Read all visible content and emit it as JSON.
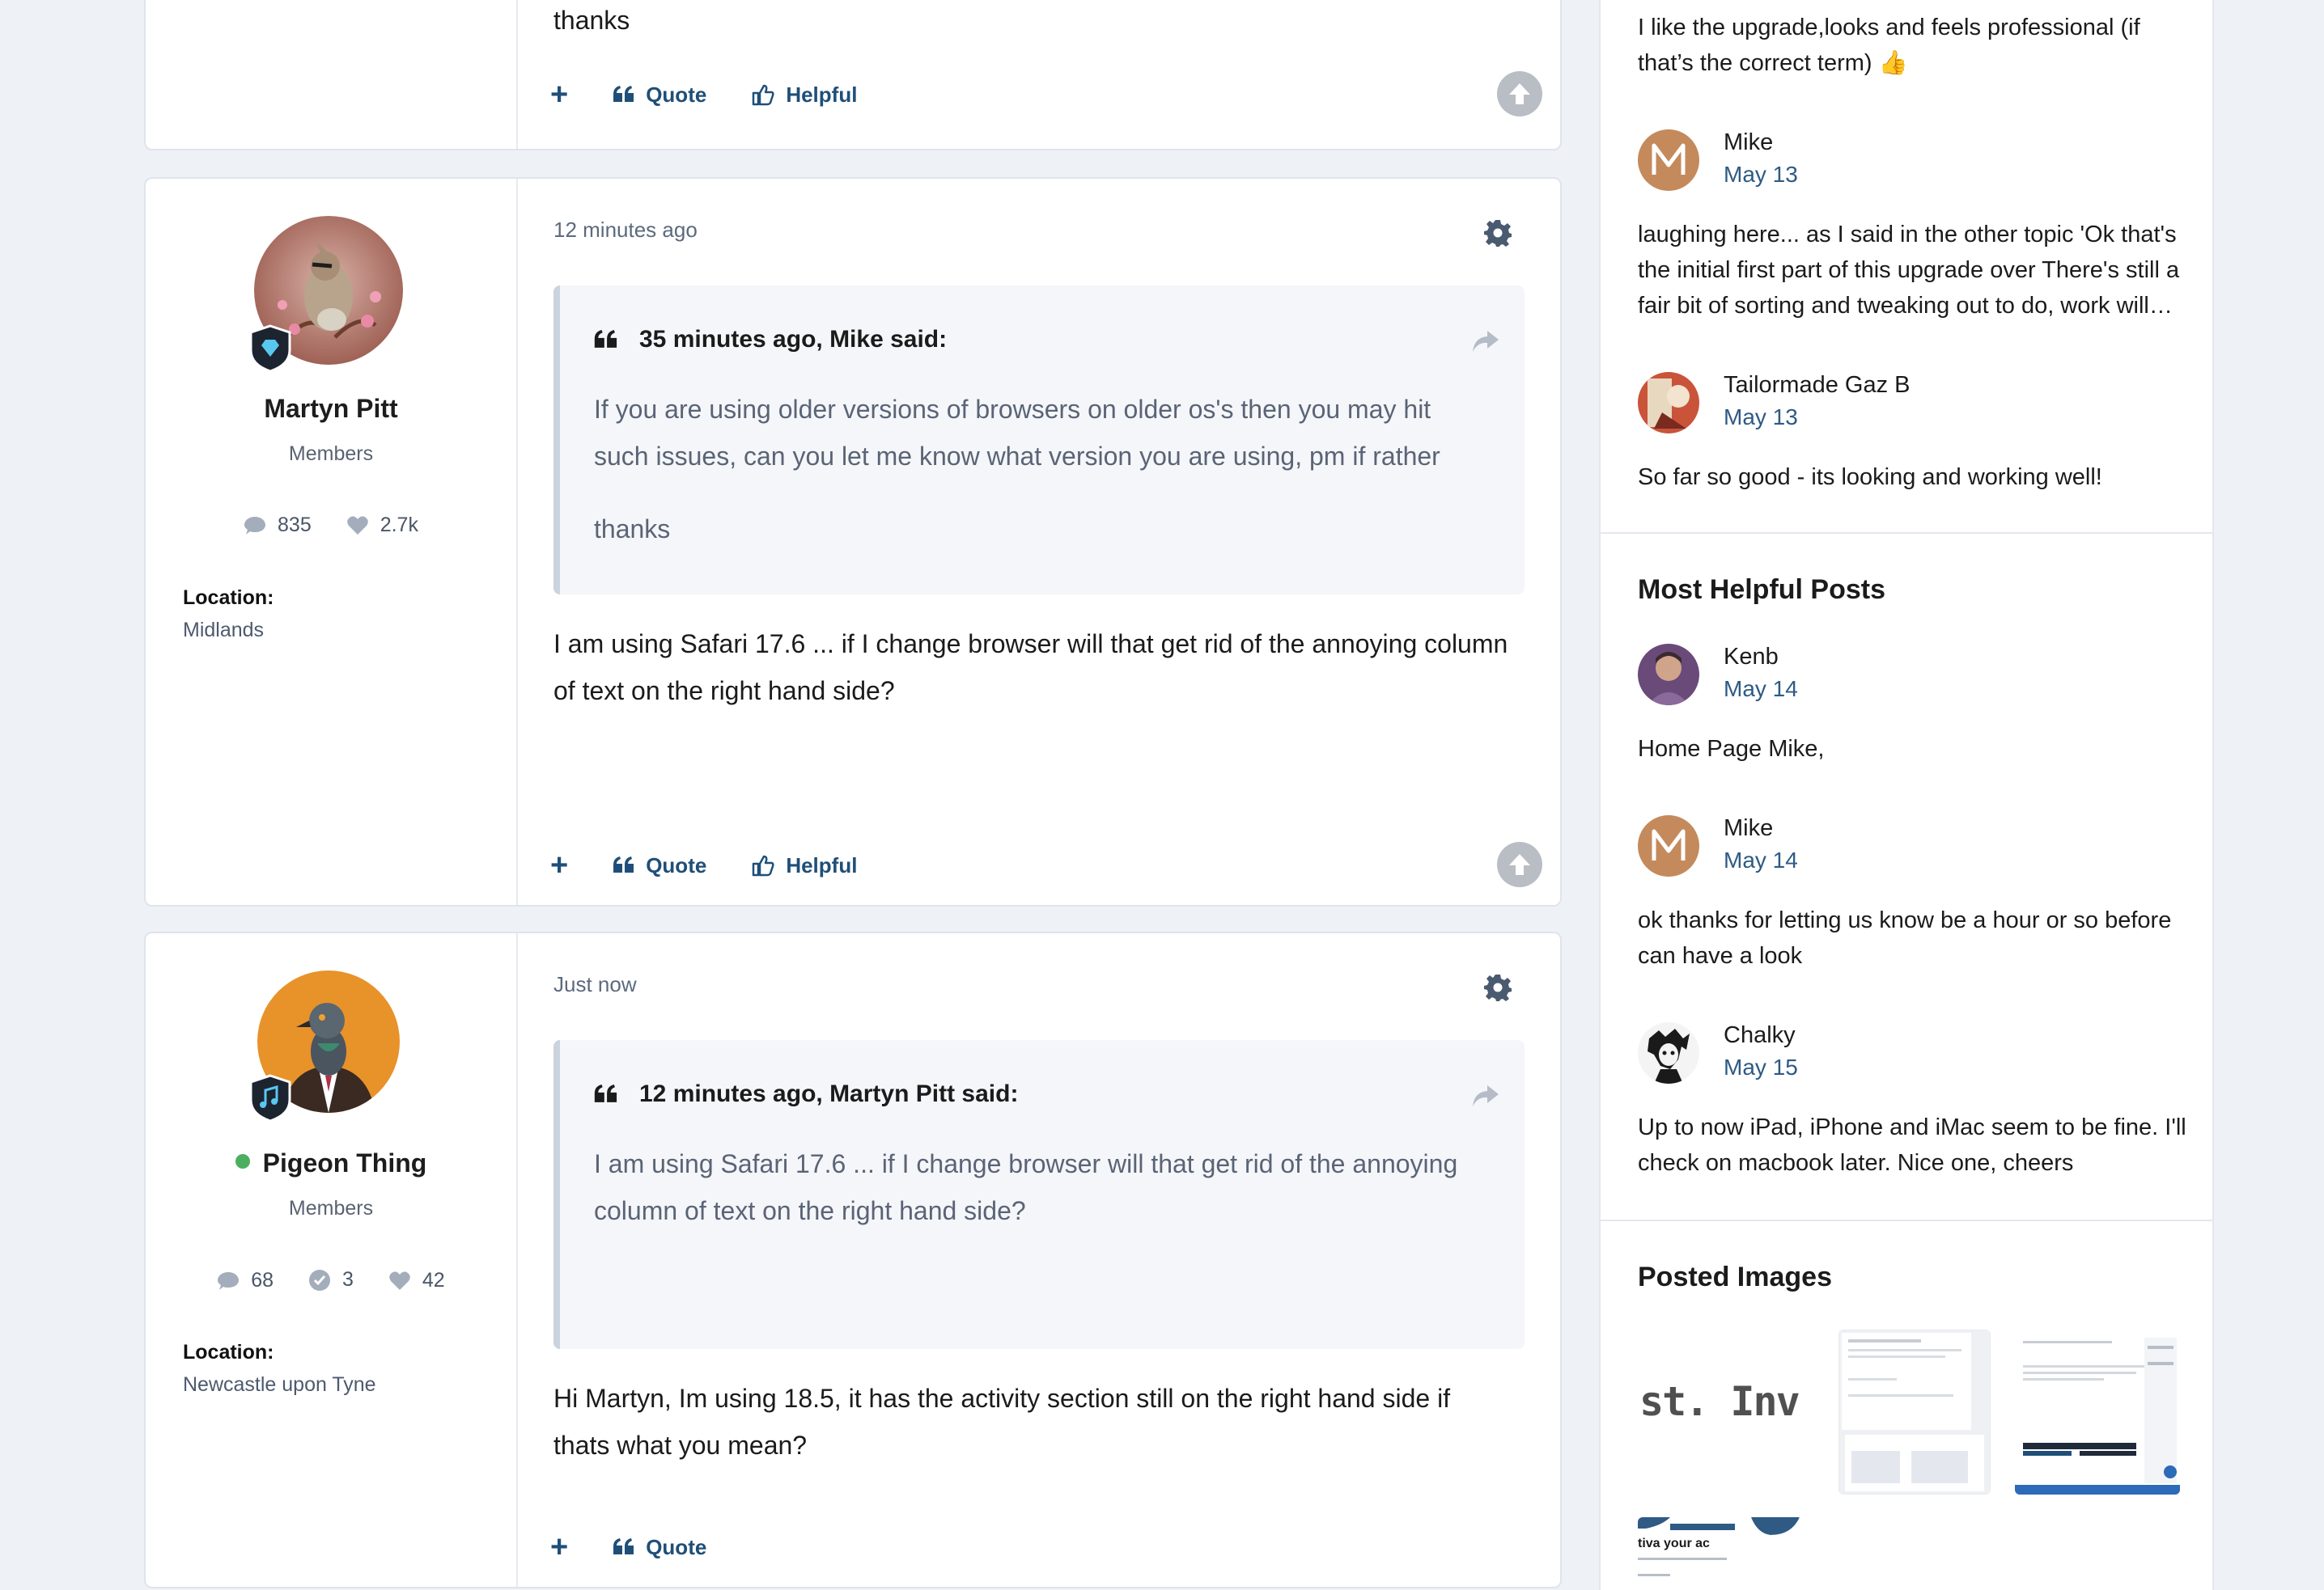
{
  "posts": [
    {
      "text": "thanks",
      "actions": {
        "plus": "+",
        "quote": "Quote",
        "helpful": "Helpful"
      }
    },
    {
      "author": {
        "name": "Martyn Pitt",
        "group": "Members",
        "posts": "835",
        "reputation": "2.7k",
        "location_label": "Location:",
        "location": "Midlands"
      },
      "timestamp": "12 minutes ago",
      "quote": {
        "header": "35 minutes ago, Mike said:",
        "line1": "If you are using older versions of browsers on older os's then you may hit such issues, can you let me know what version you are using, pm if rather",
        "line2": "thanks"
      },
      "text": "I am using Safari 17.6 ... if I change browser will that get rid of the annoying column of text on the right hand side?",
      "actions": {
        "plus": "+",
        "quote": "Quote",
        "helpful": "Helpful"
      }
    },
    {
      "author": {
        "name": "Pigeon Thing",
        "group": "Members",
        "posts": "68",
        "solutions": "3",
        "reputation": "42",
        "location_label": "Location:",
        "location": "Newcastle upon Tyne"
      },
      "timestamp": "Just now",
      "quote": {
        "header": "12 minutes ago, Martyn Pitt said:",
        "line1": "I am using Safari 17.6 ... if I change browser will that get rid of the annoying column of text on the right hand side?"
      },
      "text": "Hi Martyn, Im using 18.5, it has the activity section still on the right hand side if thats what you mean?",
      "actions": {
        "plus": "+",
        "quote": "Quote"
      }
    }
  ],
  "sidebar": {
    "top_text": "I like the upgrade,looks and feels professional (if that’s the correct term) 👍",
    "activity": [
      {
        "name": "Mike",
        "date": "May 13",
        "initial": "M",
        "text": "laughing here... as I said in the other topic 'Ok that's the initial first part of this upgrade over There's still a fair bit of sorting and tweaking out to do, work will…"
      },
      {
        "name": "Tailormade Gaz B",
        "date": "May 13",
        "text": "So far so good - its looking and working well!"
      }
    ],
    "helpful_title": "Most Helpful Posts",
    "helpful": [
      {
        "name": "Kenb",
        "date": "May 14",
        "text": "Home Page Mike,"
      },
      {
        "name": "Mike",
        "date": "May 14",
        "initial": "M",
        "text": "ok thanks for letting us know be a hour or so before can have a look"
      },
      {
        "name": "Chalky",
        "date": "May 15",
        "text": "Up to now iPad, iPhone and iMac seem to be fine. I'll check on macbook later. Nice one, cheers"
      }
    ],
    "images_title": "Posted Images",
    "thumb1_text": "st. Inv",
    "thumb4_text": "tiva   your ac"
  },
  "colors": {
    "accent": "#1f4f78",
    "date": "#2e5a84",
    "mike_avatar": "#c48a5c",
    "pigeon_avatar": "#e8922a"
  }
}
